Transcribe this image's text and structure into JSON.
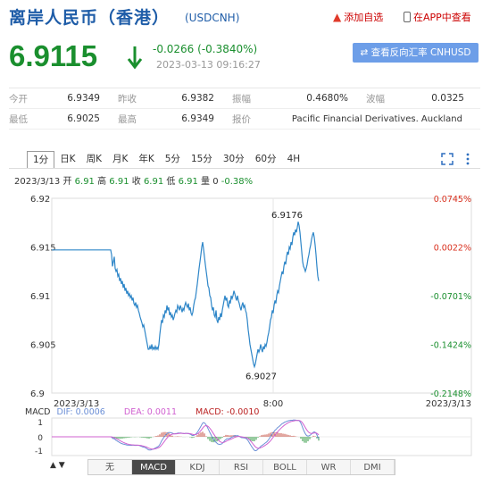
{
  "header": {
    "title": "离岸人民币（香港）",
    "code": "(USDCNH)",
    "add_watch": "添加自选",
    "open_app": "在APP中查看"
  },
  "quote": {
    "price": "6.9115",
    "change": "-0.0266 (-0.3840%)",
    "timestamp": "2023-03-13 09:16:27",
    "reverse_button": "查看反向汇率 CNHUSD"
  },
  "stats": {
    "row1": [
      {
        "label": "今开",
        "value": "6.9349"
      },
      {
        "label": "昨收",
        "value": "6.9382"
      },
      {
        "label": "振幅",
        "value": "0.4680%"
      },
      {
        "label": "波幅",
        "value": "0.0325"
      }
    ],
    "row2": [
      {
        "label": "最低",
        "value": "6.9025"
      },
      {
        "label": "最高",
        "value": "6.9349"
      },
      {
        "label": "报价",
        "value": "Pacific Financial Derivatives. Auckland"
      }
    ]
  },
  "tabs": [
    "1分",
    "日K",
    "周K",
    "月K",
    "年K",
    "5分",
    "15分",
    "30分",
    "60分",
    "4H"
  ],
  "ohlc_line": {
    "date": "2023/3/13",
    "open_lbl": "开",
    "open": "6.91",
    "high_lbl": "高",
    "high": "6.91",
    "close_lbl": "收",
    "close": "6.91",
    "low_lbl": "低",
    "low": "6.91",
    "vol_lbl": "量",
    "vol": "0",
    "chg": "-0.38%"
  },
  "chart_data": {
    "type": "line",
    "y_ticks": [
      "6.92",
      "6.915",
      "6.91",
      "6.905",
      "6.9"
    ],
    "pct_ticks": [
      "0.0745%",
      "0.0022%",
      "-0.0701%",
      "-0.1424%",
      "-0.2148%"
    ],
    "x_labels": [
      "2023/3/13",
      "8:00",
      "2023/3/13"
    ],
    "ylim": [
      6.9,
      6.92
    ],
    "annotations": {
      "max": "6.9176",
      "min": "6.9027"
    },
    "line_color": "#2e86c8",
    "series": {
      "x": [
        0,
        10,
        20,
        30,
        40,
        50,
        60,
        66,
        67,
        68,
        69,
        70,
        71,
        72,
        73,
        74,
        75,
        76,
        77,
        78,
        79,
        80,
        81,
        82,
        83,
        84,
        85,
        86,
        87,
        88,
        89,
        90,
        91,
        92,
        93,
        94,
        95,
        96,
        97,
        98,
        99,
        100,
        101,
        102,
        103,
        104,
        105,
        106,
        107,
        108,
        109,
        110,
        111,
        112,
        113,
        114,
        115,
        116,
        117,
        118,
        119,
        120,
        121,
        122,
        123,
        124,
        125,
        126,
        127,
        128,
        129,
        130,
        131,
        132,
        133,
        134,
        135,
        136,
        137,
        138,
        139,
        140,
        141,
        142,
        143,
        144,
        145,
        146,
        147,
        148,
        149,
        150,
        151,
        152,
        153,
        154,
        155,
        156,
        157,
        158,
        159,
        160,
        161,
        162,
        163,
        164,
        165,
        166,
        167,
        168,
        169,
        170,
        171,
        172,
        173,
        174,
        175,
        176,
        177,
        178,
        179,
        180,
        181,
        182,
        183,
        184,
        185,
        186,
        187,
        188,
        189,
        190,
        191,
        192,
        193,
        194,
        195,
        196,
        197,
        198,
        199,
        200,
        201,
        202,
        203,
        204,
        205,
        206,
        207,
        208,
        209,
        210,
        211,
        212,
        213,
        214,
        215,
        216,
        217,
        218,
        219,
        220,
        221,
        222,
        223,
        224,
        225,
        226,
        227,
        228,
        229,
        230,
        231,
        232,
        233,
        234,
        235,
        236,
        237,
        238,
        239,
        240,
        241,
        242,
        243,
        244,
        245,
        246,
        247,
        248,
        249,
        250,
        251,
        252,
        253,
        254,
        255,
        256,
        257,
        258,
        259,
        260,
        261,
        262,
        263,
        264,
        265,
        266,
        267,
        268,
        269,
        270,
        271,
        272,
        273,
        274,
        275,
        276,
        277,
        278,
        279,
        280,
        281,
        282,
        283,
        284,
        285,
        286,
        287,
        288,
        289,
        290,
        291,
        292,
        293,
        294,
        295,
        296,
        297,
        298,
        299,
        300,
        301,
        302,
        303,
        304,
        305,
        306,
        307,
        308,
        309,
        310,
        311,
        312,
        313,
        314,
        315,
        316,
        317,
        318,
        319,
        320,
        321,
        322,
        323,
        324,
        325,
        326,
        327,
        328,
        329,
        330,
        331,
        332,
        333,
        334,
        335,
        336,
        337,
        338,
        339,
        340,
        341,
        342,
        343,
        344,
        345,
        346,
        347,
        348,
        349,
        350,
        351,
        352,
        353,
        354,
        355,
        356,
        357,
        358,
        359,
        360,
        361,
        362,
        363,
        364,
        365,
        366,
        367,
        368,
        369,
        370,
        371,
        372,
        373,
        374,
        375,
        376,
        377,
        378,
        379,
        380,
        381,
        382,
        383,
        384,
        385,
        386,
        387,
        388,
        389,
        390,
        391,
        392,
        393,
        394,
        395,
        396,
        397,
        398,
        399,
        400,
        401,
        402,
        403,
        404,
        405,
        406,
        407,
        408,
        409,
        410,
        411,
        412,
        413,
        414,
        415,
        416,
        417,
        418,
        419,
        420,
        421,
        422,
        423,
        424,
        425,
        426,
        427,
        428,
        429,
        430,
        431,
        432,
        433,
        434,
        435,
        436,
        437,
        438,
        439,
        440,
        441,
        442,
        443,
        444,
        445,
        446,
        447,
        448,
        449,
        450,
        451,
        452,
        453,
        454,
        455,
        456,
        457,
        458,
        459,
        460,
        461,
        462,
        463,
        464,
        465,
        466,
        467,
        468,
        469,
        470
      ],
      "y": [
        6.9147,
        6.9147,
        6.9147,
        6.9147,
        6.9147,
        6.9147,
        6.9147,
        6.9147,
        6.9142,
        6.913,
        6.9135,
        6.914,
        6.9128,
        6.9125,
        6.9127,
        6.912,
        6.9122,
        6.9115,
        6.9118,
        6.9112,
        6.9115,
        6.9108,
        6.9112,
        6.9105,
        6.9108,
        6.9102,
        6.9105,
        6.91,
        6.9102,
        6.9098,
        6.91,
        6.9095,
        6.9098,
        6.9092,
        6.909,
        6.9093,
        6.9088,
        6.909,
        6.9085,
        6.9082,
        6.9078,
        6.9075,
        6.9072,
        6.9068,
        6.907,
        6.9065,
        6.906,
        6.9055,
        6.905,
        6.9045,
        6.9045,
        6.9048,
        6.9045,
        6.905,
        6.9045,
        6.9047,
        6.9045,
        6.9048,
        6.9045,
        6.9047,
        6.9045,
        6.905,
        6.906,
        6.9068,
        6.9075,
        6.9072,
        6.908,
        6.9078,
        6.9085,
        6.9082,
        6.909,
        6.9085,
        6.9088,
        6.908,
        6.9083,
        6.9078,
        6.908,
        6.9075,
        6.9078,
        6.9082,
        6.9085,
        6.9083,
        6.909,
        6.9088,
        6.9085,
        6.909,
        6.9087,
        6.9083,
        6.9087,
        6.9085,
        6.909,
        6.9093,
        6.909,
        6.9088,
        6.9092,
        6.9085,
        6.9088,
        6.9082,
        6.908,
        6.9083,
        6.909,
        6.9095,
        6.9098,
        6.9105,
        6.9112,
        6.912,
        6.9128,
        6.9135,
        6.9142,
        6.915,
        6.9155,
        6.9148,
        6.914,
        6.9132,
        6.9125,
        6.9118,
        6.911,
        6.9108,
        6.91,
        6.9098,
        6.909,
        6.9085,
        6.9088,
        6.908,
        6.9078,
        6.9085,
        6.9075,
        6.9072,
        6.9078,
        6.9075,
        6.9082,
        6.9078,
        6.9085,
        6.909,
        6.9095,
        6.91,
        6.9095,
        6.9098,
        6.909,
        6.9088,
        6.9095,
        6.9092,
        6.91,
        6.9097,
        6.91,
        6.9105,
        6.9102,
        6.9098,
        6.9095,
        6.91,
        6.9095,
        6.9092,
        6.9088,
        6.9085,
        6.909,
        6.9093,
        6.9088,
        6.909,
        6.9085,
        6.9082,
        6.9075,
        6.9065,
        6.9058,
        6.905,
        6.9045,
        6.904,
        6.9035,
        6.903,
        6.9027,
        6.903,
        6.9035,
        6.904,
        6.9045,
        6.9042,
        6.9045,
        6.905,
        6.9045,
        6.9042,
        6.9048,
        6.9045,
        6.905,
        6.9048,
        6.9052,
        6.9058,
        6.9062,
        6.9068,
        6.9075,
        6.9078,
        6.9085,
        6.9082,
        6.909,
        6.9095,
        6.9092,
        6.91,
        6.9105,
        6.9103,
        6.911,
        6.9115,
        6.912,
        6.9125,
        6.9122,
        6.913,
        6.9135,
        6.9132,
        6.914,
        6.9145,
        6.9142,
        6.915,
        6.9148,
        6.9155,
        6.9152,
        6.916,
        6.9165,
        6.9162,
        6.9168,
        6.9165,
        6.917,
        6.9176,
        6.9172,
        6.9165,
        6.9155,
        6.9145,
        6.9135,
        6.913,
        6.9128,
        6.9125,
        6.9128,
        6.9132,
        6.9138,
        6.9142,
        6.9148,
        6.9152,
        6.9158,
        6.9162,
        6.9165,
        6.916,
        6.9152,
        6.9142,
        6.913,
        6.912,
        6.9115
      ]
    }
  },
  "macd": {
    "label": "MACD",
    "dif_lbl": "DIF:",
    "dif": "0.0006",
    "dea_lbl": "DEA:",
    "dea": "0.0011",
    "macd_lbl": "MACD:",
    "macd": "-0.0010",
    "y_ticks": [
      "1",
      "0",
      "-1"
    ]
  },
  "indicator_tabs": [
    "无",
    "MACD",
    "KDJ",
    "RSI",
    "BOLL",
    "WR",
    "DMI"
  ]
}
